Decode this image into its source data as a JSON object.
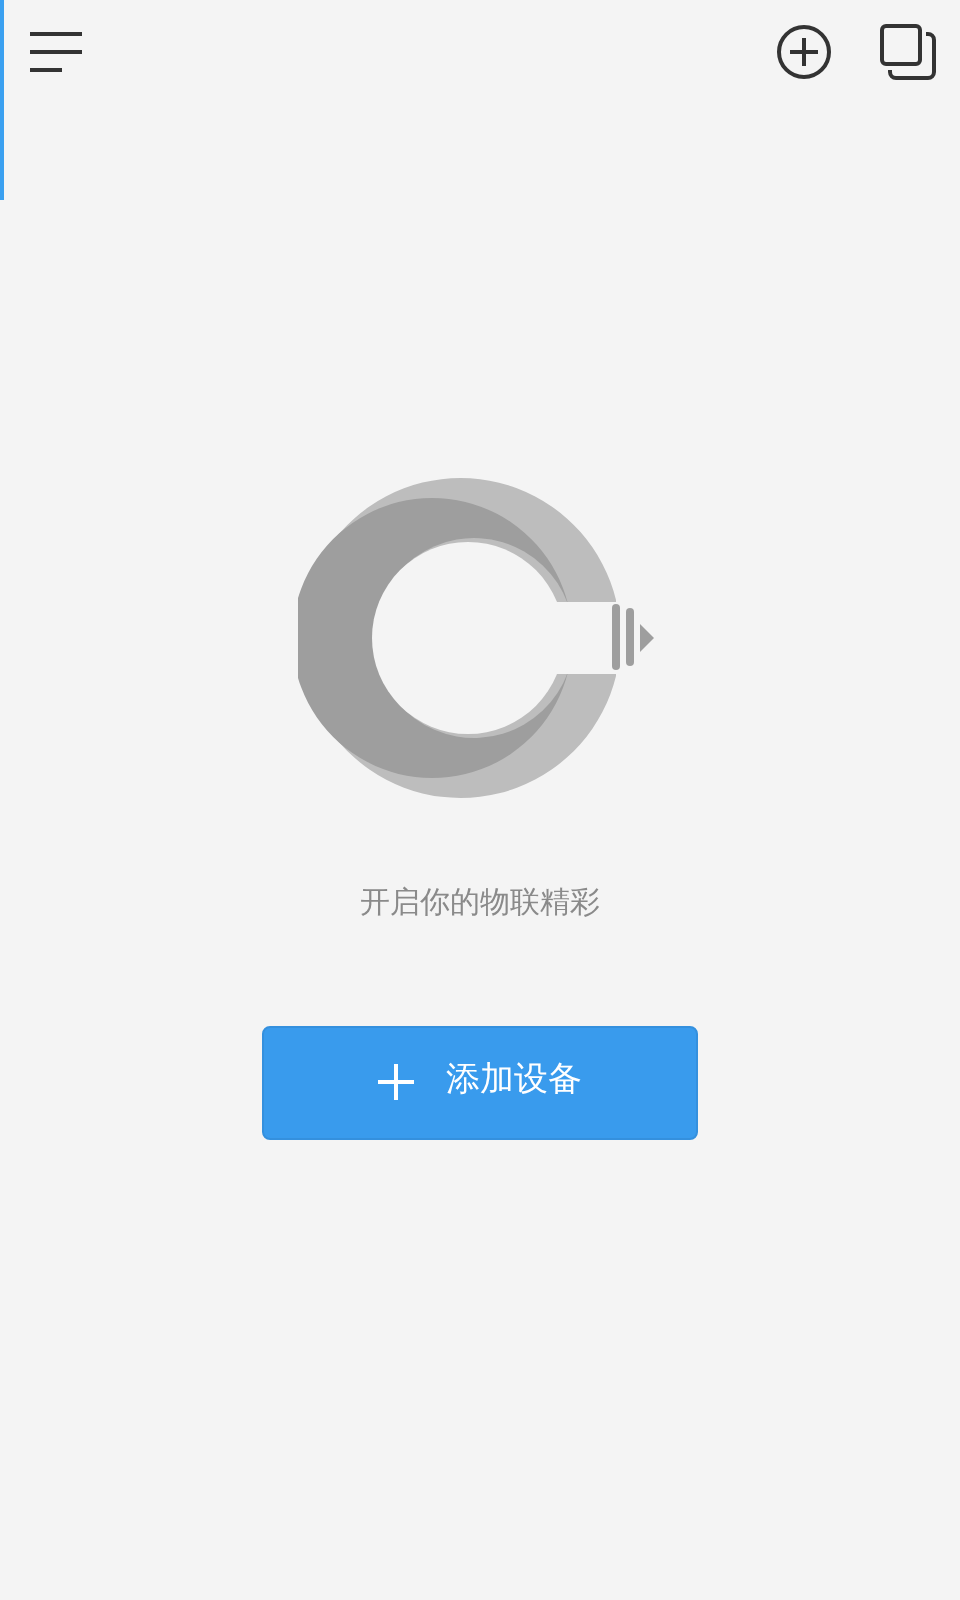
{
  "empty_state": {
    "message": "开启你的物联精彩"
  },
  "add_button": {
    "label": "添加设备"
  }
}
